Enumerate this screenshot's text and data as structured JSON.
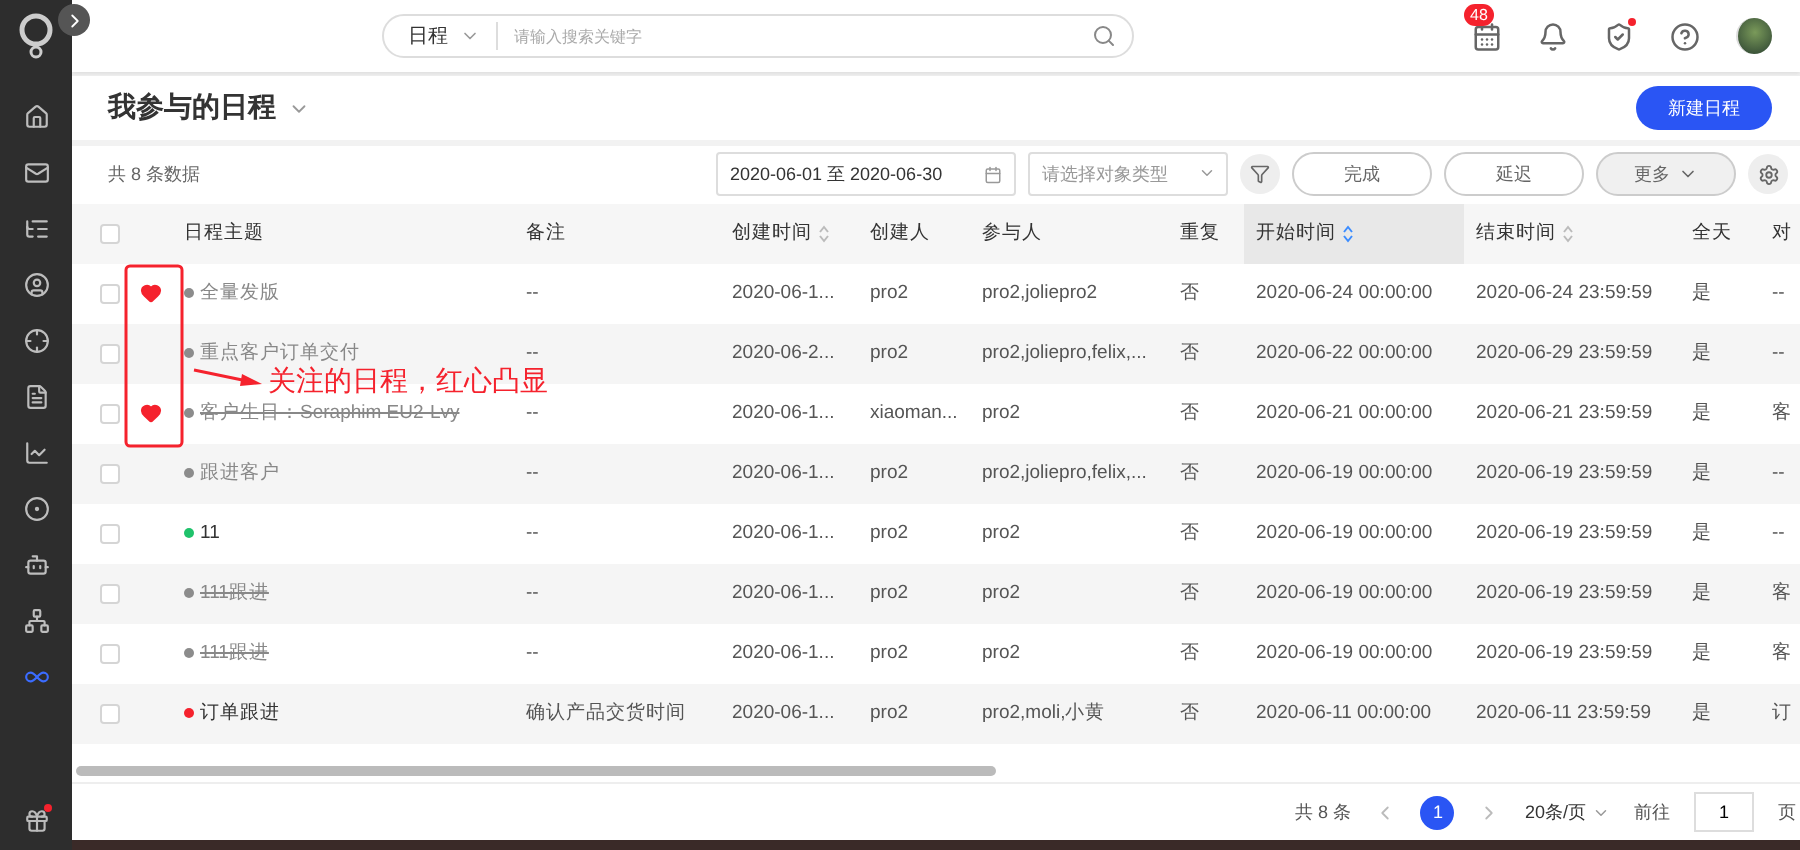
{
  "sidebar": {
    "items": [
      {
        "selected": false
      },
      {
        "selected": false
      },
      {
        "selected": false
      },
      {
        "selected": false
      },
      {
        "selected": false
      },
      {
        "selected": false
      },
      {
        "selected": false
      },
      {
        "selected": false
      },
      {
        "selected": false
      },
      {
        "selected": false
      },
      {
        "selected": true
      }
    ],
    "bottom_alert": true
  },
  "topbar": {
    "search": {
      "scope": "日程",
      "placeholder": "请输入搜索关键字"
    },
    "notification_count": "48",
    "security_alert": true
  },
  "page": {
    "title": "我参与的日程",
    "new_button": "新建日程"
  },
  "toolbar": {
    "count": "共 8 条数据",
    "date_range": "2020-06-01 至 2020-06-30",
    "type_select": {
      "placeholder": "请选择对象类型"
    },
    "buttons": [
      "完成",
      "延迟"
    ],
    "more": "更多"
  },
  "table": {
    "all_checked": false,
    "columns": [
      {
        "label": "日程主题",
        "sortable": false,
        "sorted": false
      },
      {
        "label": "备注",
        "sortable": false,
        "sorted": false
      },
      {
        "label": "创建时间",
        "sortable": true,
        "sorted": false
      },
      {
        "label": "创建人",
        "sortable": false,
        "sorted": false
      },
      {
        "label": "参与人",
        "sortable": false,
        "sorted": false
      },
      {
        "label": "重复",
        "sortable": false,
        "sorted": false
      },
      {
        "label": "开始时间",
        "sortable": true,
        "sorted": true
      },
      {
        "label": "结束时间",
        "sortable": true,
        "sorted": false
      },
      {
        "label": "全天",
        "sortable": false,
        "sorted": false
      },
      {
        "label": "对",
        "sorted": false
      }
    ],
    "rows": [
      {
        "checked": false,
        "favorite": true,
        "color": "#8c8c8c",
        "dimmed": true,
        "struck": false,
        "cells": [
          "全量发版",
          "--",
          "2020-06-1...",
          "pro2",
          "pro2,joliepro2",
          "否",
          "2020-06-24 00:00:00",
          "2020-06-24 23:59:59",
          "是",
          "--"
        ]
      },
      {
        "checked": false,
        "favorite": false,
        "color": "#8c8c8c",
        "dimmed": true,
        "struck": false,
        "cells": [
          "重点客户订单交付",
          "--",
          "2020-06-2...",
          "pro2",
          "pro2,joliepro,felix,...",
          "否",
          "2020-06-22 00:00:00",
          "2020-06-29 23:59:59",
          "是",
          "--"
        ]
      },
      {
        "checked": false,
        "favorite": true,
        "color": "#8c8c8c",
        "dimmed": true,
        "struck": true,
        "cells": [
          "客户生日：Seraphim EU2-Lvy",
          "--",
          "2020-06-1...",
          "xiaoman...",
          "pro2",
          "否",
          "2020-06-21 00:00:00",
          "2020-06-21 23:59:59",
          "是",
          "客"
        ]
      },
      {
        "checked": false,
        "favorite": false,
        "color": "#8c8c8c",
        "dimmed": true,
        "struck": false,
        "cells": [
          "跟进客户",
          "--",
          "2020-06-1...",
          "pro2",
          "pro2,joliepro,felix,...",
          "否",
          "2020-06-19 00:00:00",
          "2020-06-19 23:59:59",
          "是",
          "--"
        ]
      },
      {
        "checked": false,
        "favorite": false,
        "color": "#1fc26b",
        "dimmed": false,
        "struck": false,
        "cells": [
          "11",
          "--",
          "2020-06-1...",
          "pro2",
          "pro2",
          "否",
          "2020-06-19 00:00:00",
          "2020-06-19 23:59:59",
          "是",
          "--"
        ]
      },
      {
        "checked": false,
        "favorite": false,
        "color": "#8c8c8c",
        "dimmed": true,
        "struck": true,
        "cells": [
          "111跟进",
          "--",
          "2020-06-1...",
          "pro2",
          "pro2",
          "否",
          "2020-06-19 00:00:00",
          "2020-06-19 23:59:59",
          "是",
          "客"
        ]
      },
      {
        "checked": false,
        "favorite": false,
        "color": "#8c8c8c",
        "dimmed": true,
        "struck": true,
        "cells": [
          "111跟进",
          "--",
          "2020-06-1...",
          "pro2",
          "pro2",
          "否",
          "2020-06-19 00:00:00",
          "2020-06-19 23:59:59",
          "是",
          "客"
        ]
      },
      {
        "checked": false,
        "favorite": false,
        "color": "#f5222d",
        "dimmed": false,
        "struck": false,
        "cells": [
          "订单跟进",
          "确认产品交货时间",
          "2020-06-1...",
          "pro2",
          "pro2,moli,小黄",
          "否",
          "2020-06-11 00:00:00",
          "2020-06-11 23:59:59",
          "是",
          "订"
        ]
      }
    ]
  },
  "annotation": {
    "text": "关注的日程，红心凸显"
  },
  "pagination": {
    "total": "共 8 条",
    "pages": [
      {
        "label": "1",
        "selected": true
      }
    ],
    "page_size": "20条/页",
    "goto_label": "前往",
    "goto_value": "1",
    "goto_suffix": "页"
  }
}
